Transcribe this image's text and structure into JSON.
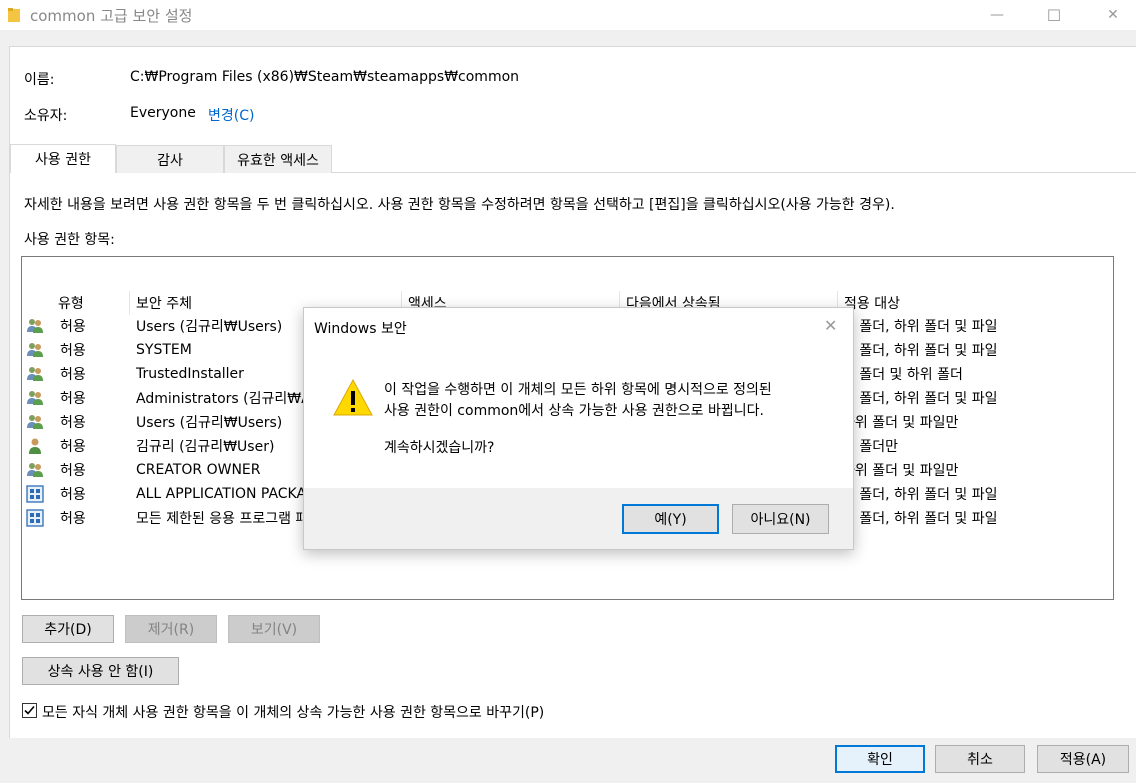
{
  "window": {
    "title": "common 고급 보안 설정",
    "minimize_glyph": "—",
    "maximize_glyph": "☐",
    "close_glyph": "✕"
  },
  "info": {
    "name_label": "이름:",
    "name_value": "C:₩Program Files (x86)₩Steam₩steamapps₩common",
    "owner_label": "소유자:",
    "owner_value": "Everyone",
    "change_link": "변경(C)"
  },
  "tabs": [
    {
      "label": "사용 권한",
      "active": true
    },
    {
      "label": "감사",
      "active": false
    },
    {
      "label": "유효한 액세스",
      "active": false
    }
  ],
  "instruction": "자세한 내용을 보려면 사용 권한 항목을 두 번 클릭하십시오. 사용 권한 항목을 수정하려면 항목을 선택하고 [편집]을 클릭하십시오(사용 가능한 경우).",
  "entries_label": "사용 권한 항목:",
  "columns": [
    "유형",
    "보안 주체",
    "액세스",
    "다음에서 상속됨",
    "적용 대상"
  ],
  "rows": [
    {
      "icon": "group-users-icon",
      "type": "허용",
      "principal": "Users (김규리₩Users)",
      "applies": "이 폴더, 하위 폴더 및 파일"
    },
    {
      "icon": "group-users-icon",
      "type": "허용",
      "principal": "SYSTEM",
      "applies": "이 폴더, 하위 폴더 및 파일"
    },
    {
      "icon": "group-users-icon",
      "type": "허용",
      "principal": "TrustedInstaller",
      "applies": "이 폴더 및 하위 폴더"
    },
    {
      "icon": "group-users-icon",
      "type": "허용",
      "principal": "Administrators (김규리₩Administrators)",
      "applies": "이 폴더, 하위 폴더 및 파일"
    },
    {
      "icon": "group-users-icon",
      "type": "허용",
      "principal": "Users (김규리₩Users)",
      "applies": "하위 폴더 및 파일만"
    },
    {
      "icon": "user-icon",
      "type": "허용",
      "principal": "김규리 (김규리₩User)",
      "applies": "이 폴더만"
    },
    {
      "icon": "group-users-icon",
      "type": "허용",
      "principal": "CREATOR OWNER",
      "applies": "하위 폴더 및 파일만"
    },
    {
      "icon": "app-package-icon",
      "type": "허용",
      "principal": "ALL APPLICATION PACKAGES",
      "applies": "이 폴더, 하위 폴더 및 파일"
    },
    {
      "icon": "app-package-icon",
      "type": "허용",
      "principal": "모든 제한된 응용 프로그램 패키지",
      "applies": "이 폴더, 하위 폴더 및 파일"
    }
  ],
  "buttons": {
    "add": "추가(D)",
    "remove": "제거(R)",
    "view": "보기(V)",
    "disable_inheritance": "상속 사용 안 함(I)",
    "ok": "확인",
    "cancel": "취소",
    "apply": "적용(A)"
  },
  "replace_checkbox": {
    "label": "모든 자식 개체 사용 권한 항목을 이 개체의 상속 가능한 사용 권한 항목으로 바꾸기(P)",
    "checked": true
  },
  "dialog": {
    "title": "Windows 보안",
    "close_glyph": "✕",
    "message_line1": "이 작업을 수행하면 이 개체의 모든 하위 항목에 명시적으로 정의된",
    "message_line2": "사용 권한이 common에서 상속 가능한 사용 권한으로 바뀝니다.",
    "question": "계속하시겠습니까?",
    "yes": "예(Y)",
    "no": "아니요(N)"
  },
  "colors": {
    "accent": "#0078d7",
    "link": "#0066cc",
    "warning": "#ffd800"
  }
}
